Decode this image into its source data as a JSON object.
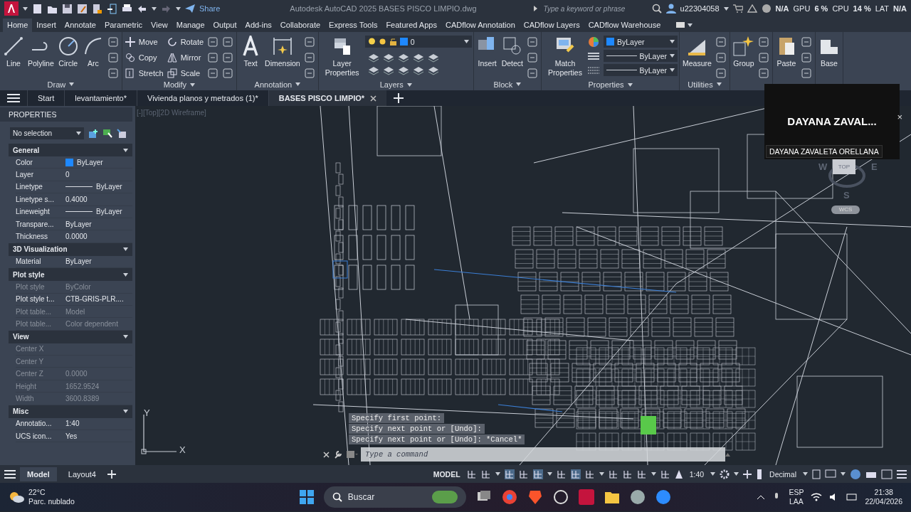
{
  "title_bar": {
    "share": "Share",
    "title": "Autodesk AutoCAD 2025   BASES PISCO LIMPIO.dwg",
    "search": {
      "placeholder": "Type a keyword or phrase"
    },
    "user": "u22304058",
    "fps": "N/A",
    "perf": [
      {
        "label": "GPU",
        "value": "6 %"
      },
      {
        "label": "CPU",
        "value": "14 %"
      },
      {
        "label": "LAT",
        "value": "N/A"
      }
    ]
  },
  "ribbon_tabs": [
    {
      "label": "Home",
      "selected": true
    },
    {
      "label": "Insert",
      "selected": false
    },
    {
      "label": "Annotate",
      "selected": false
    },
    {
      "label": "Parametric",
      "selected": false
    },
    {
      "label": "View",
      "selected": false
    },
    {
      "label": "Manage",
      "selected": false
    },
    {
      "label": "Output",
      "selected": false
    },
    {
      "label": "Add-ins",
      "selected": false
    },
    {
      "label": "Collaborate",
      "selected": false
    },
    {
      "label": "Express Tools",
      "selected": false
    },
    {
      "label": "Featured Apps",
      "selected": false
    },
    {
      "label": "CADflow Annotation",
      "selected": false
    },
    {
      "label": "CADflow Layers",
      "selected": false
    },
    {
      "label": "CADflow Warehouse",
      "selected": false
    }
  ],
  "ribbon_panels": [
    {
      "title": "Draw",
      "tools": [
        {
          "kind": "large",
          "label": "Line"
        },
        {
          "kind": "large",
          "label": "Polyline"
        },
        {
          "kind": "large",
          "label": "Circle"
        },
        {
          "kind": "large",
          "label": "Arc"
        },
        {
          "kind": "icons"
        }
      ]
    },
    {
      "title": "Modify",
      "tools": [
        {
          "kind": "small",
          "label": "Move"
        },
        {
          "kind": "small",
          "label": "Copy"
        },
        {
          "kind": "small",
          "label": "Stretch"
        },
        {
          "kind": "small",
          "label": "Rotate"
        },
        {
          "kind": "small",
          "label": "Mirror"
        },
        {
          "kind": "small",
          "label": "Scale"
        },
        {
          "kind": "icons"
        },
        {
          "kind": "icons"
        }
      ]
    },
    {
      "title": "Annotation",
      "tools": [
        {
          "kind": "large",
          "label": "Text"
        },
        {
          "kind": "large",
          "label": "Dimension"
        },
        {
          "kind": "icons"
        }
      ]
    },
    {
      "title": "Layers",
      "tools": [
        {
          "kind": "large",
          "label": "Layer Properties"
        },
        {
          "kind": "layer_combo",
          "value": "0"
        }
      ]
    },
    {
      "title": "Block",
      "tools": [
        {
          "kind": "large",
          "label": "Insert"
        },
        {
          "kind": "large",
          "label": "Detect"
        },
        {
          "kind": "icons"
        }
      ]
    },
    {
      "title": "Properties",
      "tools": [
        {
          "kind": "large",
          "label": "Match Properties"
        },
        {
          "kind": "prop_combos",
          "values": [
            "ByLayer",
            "ByLayer",
            "ByLayer"
          ]
        }
      ]
    },
    {
      "title": "Utilities",
      "tools": [
        {
          "kind": "large",
          "label": "Measure"
        },
        {
          "kind": "icons"
        }
      ]
    },
    {
      "tools": [
        {
          "kind": "large",
          "label": "Group"
        },
        {
          "kind": "icons"
        }
      ]
    },
    {
      "tools": [
        {
          "kind": "large",
          "label": "Paste"
        },
        {
          "kind": "icons"
        }
      ]
    },
    {
      "tools": [
        {
          "kind": "large",
          "label": "Base"
        }
      ]
    }
  ],
  "file_tabs": [
    {
      "label": "Start",
      "selected": false
    },
    {
      "label": "levantamiento*",
      "selected": false
    },
    {
      "label": "Vivienda planos y metrados (1)*",
      "selected": false
    },
    {
      "label": "BASES PISCO LIMPIO*",
      "selected": true
    }
  ],
  "properties": {
    "title": "PROPERTIES",
    "selection": "No selection",
    "sections": [
      {
        "title": "General",
        "rows": [
          {
            "kind": "color",
            "label": "Color",
            "value": "ByLayer",
            "disabled": false
          },
          {
            "kind": "text",
            "label": "Layer",
            "value": "0",
            "disabled": false
          },
          {
            "kind": "line",
            "label": "Linetype",
            "value": "ByLayer",
            "disabled": false
          },
          {
            "kind": "text",
            "label": "Linetype s...",
            "value": "0.4000",
            "disabled": false
          },
          {
            "kind": "line",
            "label": "Lineweight",
            "value": "ByLayer",
            "disabled": false
          },
          {
            "kind": "text",
            "label": "Transpare...",
            "value": "ByLayer",
            "disabled": false
          },
          {
            "kind": "text",
            "label": "Thickness",
            "value": "0.0000",
            "disabled": false
          }
        ]
      },
      {
        "title": "3D Visualization",
        "rows": [
          {
            "kind": "text",
            "label": "Material",
            "value": "ByLayer",
            "disabled": false
          }
        ]
      },
      {
        "title": "Plot style",
        "rows": [
          {
            "kind": "text",
            "label": "Plot style",
            "value": "ByColor",
            "disabled": true
          },
          {
            "kind": "text",
            "label": "Plot style t...",
            "value": "CTB-GRIS-PLR....",
            "disabled": false
          },
          {
            "kind": "text",
            "label": "Plot table...",
            "value": "Model",
            "disabled": true
          },
          {
            "kind": "text",
            "label": "Plot table...",
            "value": "Color dependent",
            "disabled": true
          }
        ]
      },
      {
        "title": "View",
        "rows": [
          {
            "kind": "text",
            "label": "Center X",
            "disabled": true
          },
          {
            "kind": "text",
            "label": "Center Y",
            "disabled": true
          },
          {
            "kind": "text",
            "label": "Center Z",
            "value": "0.0000",
            "disabled": true
          },
          {
            "kind": "text",
            "label": "Height",
            "value": "1652.9524",
            "disabled": true
          },
          {
            "kind": "text",
            "label": "Width",
            "value": "3600.8389",
            "disabled": true
          }
        ]
      },
      {
        "title": "Misc",
        "rows": [
          {
            "kind": "text",
            "label": "Annotatio...",
            "value": "1:40",
            "disabled": false
          },
          {
            "kind": "text",
            "label": "UCS icon...",
            "value": "Yes",
            "disabled": false
          }
        ]
      }
    ]
  },
  "canvas": {
    "viewport_label": "[-][Top][2D Wireframe]",
    "viewcube": {
      "top": "TOP",
      "west": "W",
      "east": "E",
      "south": "S",
      "wcs": "WCS"
    },
    "ucs": {
      "x": "X",
      "y": "Y"
    },
    "command_history": [
      "Specify first point:",
      "Specify next point or [Undo]:",
      "Specify next point or [Undo]: *Cancel*"
    ],
    "command_input": {
      "placeholder": "Type a command"
    }
  },
  "call_overlay": {
    "name": "DAYANA ZAVAL...",
    "tooltip": "DAYANA ZAVALETA ORELLANA",
    "close": "×"
  },
  "layout_tabs": [
    {
      "label": "Model",
      "selected": true
    },
    {
      "label": "Layout4",
      "selected": false
    }
  ],
  "status_bar": {
    "space": "MODEL",
    "scale": "1:40",
    "units": "Decimal"
  },
  "taskbar": {
    "temperature": "22°C",
    "weather": "Parc. nublado",
    "search": "Buscar",
    "language": "ESP",
    "layout": "LAA",
    "time": "21:38",
    "date": "22/04/2026"
  }
}
